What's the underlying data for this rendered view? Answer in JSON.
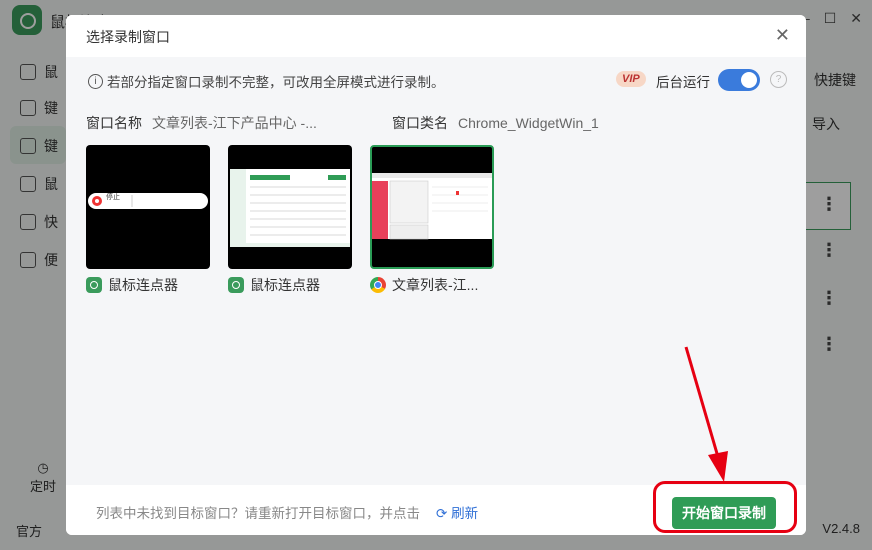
{
  "app": {
    "title": "鼠标连点器",
    "sidebar": [
      "鼠",
      "键",
      "键",
      "鼠",
      "快",
      "便"
    ],
    "right_texts": {
      "shortcut": "快捷键",
      "import": "导入"
    },
    "timer_label": "定时",
    "official": "官方",
    "version": "V2.4.8"
  },
  "dialog": {
    "title": "选择录制窗口",
    "info": "若部分指定窗口录制不完整，可改用全屏模式进行录制。",
    "vip": "VIP",
    "background_run": "后台运行",
    "toggle_on": true,
    "window_name_label": "窗口名称",
    "window_name_value": "文章列表-江下产品中心 -...",
    "window_class_label": "窗口类名",
    "window_class_value": "Chrome_WidgetWin_1",
    "windows": [
      {
        "label": "鼠标连点器",
        "icon": "mouse-clicker-app-icon",
        "selected": false
      },
      {
        "label": "鼠标连点器",
        "icon": "mouse-clicker-app-icon",
        "selected": false
      },
      {
        "label": "文章列表-江...",
        "icon": "chrome-icon",
        "selected": true
      }
    ],
    "thumb_pill_text": "停止",
    "footer_text": "列表中未找到目标窗口？请重新打开目标窗口，并点击",
    "refresh_label": "刷新",
    "start_button": "开始窗口录制"
  },
  "colors": {
    "accent": "#2f9c56",
    "highlight": "#e60012",
    "toggle": "#3a7bdc"
  }
}
